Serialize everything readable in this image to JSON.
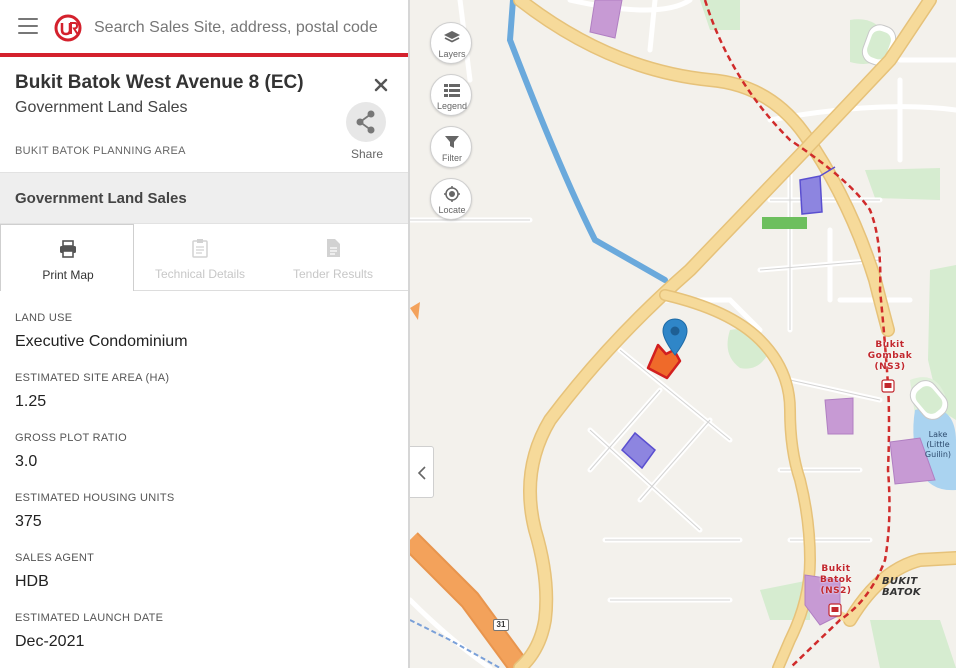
{
  "search": {
    "placeholder": "Search Sales Site, address, postal code"
  },
  "site": {
    "title": "Bukit Batok West Avenue 8 (EC)",
    "subtitle": "Government Land Sales",
    "planning_area": "BUKIT BATOK PLANNING AREA",
    "share_label": "Share"
  },
  "section": {
    "title": "Government Land Sales"
  },
  "tabs": [
    {
      "label": "Print Map",
      "enabled": true
    },
    {
      "label": "Technical Details",
      "enabled": false
    },
    {
      "label": "Tender Results",
      "enabled": false
    }
  ],
  "details": [
    {
      "label": "LAND USE",
      "value": "Executive Condominium"
    },
    {
      "label": "ESTIMATED SITE AREA (HA)",
      "value": "1.25"
    },
    {
      "label": "GROSS PLOT RATIO",
      "value": "3.0"
    },
    {
      "label": "ESTIMATED HOUSING UNITS",
      "value": "375"
    },
    {
      "label": "SALES AGENT",
      "value": "HDB"
    },
    {
      "label": "ESTIMATED LAUNCH DATE",
      "value": "Dec-2021"
    }
  ],
  "map_controls": [
    {
      "label": "Layers",
      "icon": "layers-icon"
    },
    {
      "label": "Legend",
      "icon": "legend-icon"
    },
    {
      "label": "Filter",
      "icon": "filter-icon"
    },
    {
      "label": "Locate",
      "icon": "locate-icon"
    }
  ],
  "map_labels": {
    "station_gombak": [
      "Bukit",
      "Gombak",
      "(NS3)"
    ],
    "station_batok": [
      "Bukit",
      "Batok",
      "(NS2)"
    ],
    "lake": [
      "Lake",
      "(Little",
      "Guilin)"
    ],
    "town": "BUKIT BATOK",
    "road_number": "31"
  },
  "colors": {
    "brand_red": "#d4212d",
    "selected_site": "#ef6a2a",
    "selected_site_outline": "#d21f1f",
    "marker": "#2f86c8",
    "mrt_line": "#d02b2b",
    "major_road": "#f6da9a",
    "expressway": "#f3a25b",
    "canal": "#6aa9dc",
    "park": "#d6ecd0"
  }
}
